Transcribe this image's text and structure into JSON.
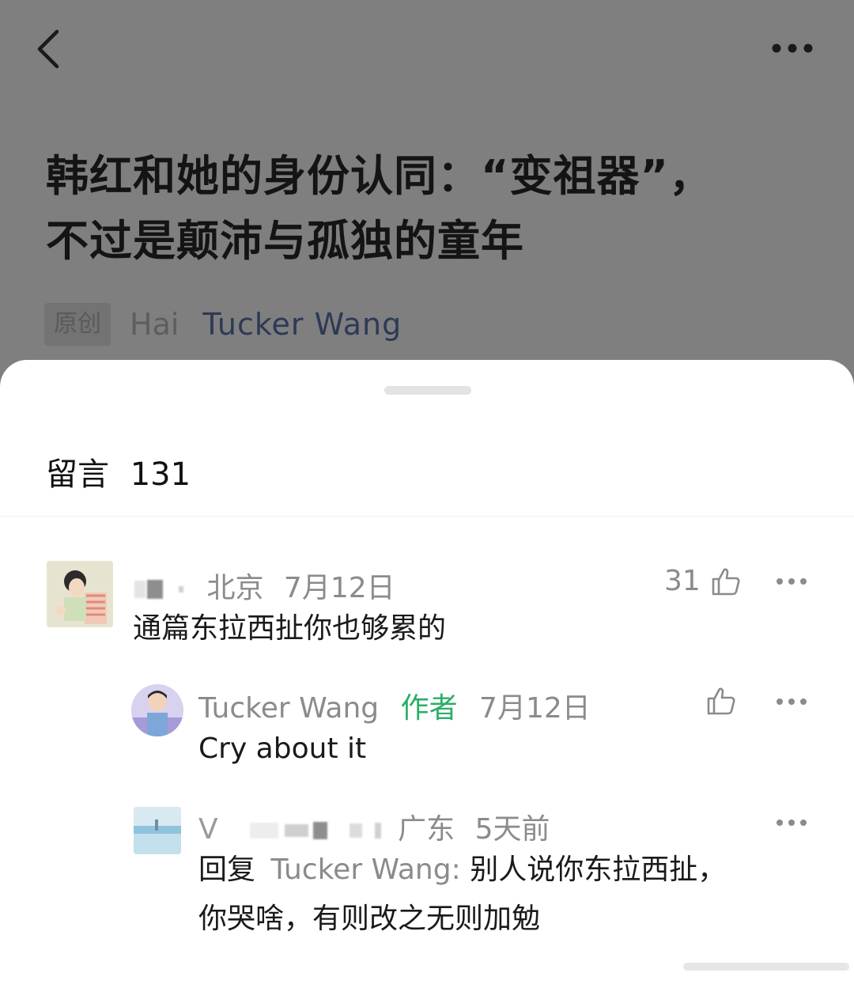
{
  "article": {
    "title_line1": "韩红和她的身份认同：“变祖器”，",
    "title_line2": "不过是颠沛与孤独的童年",
    "badge": "原创",
    "author_prefix": "Hai",
    "author_name": "Tucker Wang"
  },
  "comments_sheet": {
    "label": "留言",
    "count": "131"
  },
  "comments": [
    {
      "location": "北京",
      "date": "7月12日",
      "likes": "31",
      "text": "通篇东拉西扯你也够累的"
    }
  ],
  "replies": [
    {
      "name": "Tucker Wang",
      "tag": "作者",
      "date": "7月12日",
      "text": "Cry about it"
    },
    {
      "name_initial": "V",
      "location": "广东",
      "date": "5天前",
      "reply_prefix": "回复",
      "reply_to": "Tucker Wang",
      "reply_colon": ":",
      "text_line1": "别人说你东拉西扯，",
      "text_line2": "你哭啥，有则改之无则加勉"
    }
  ],
  "colors": {
    "accent_green": "#2aae67",
    "author_blue": "#2d3a55"
  }
}
